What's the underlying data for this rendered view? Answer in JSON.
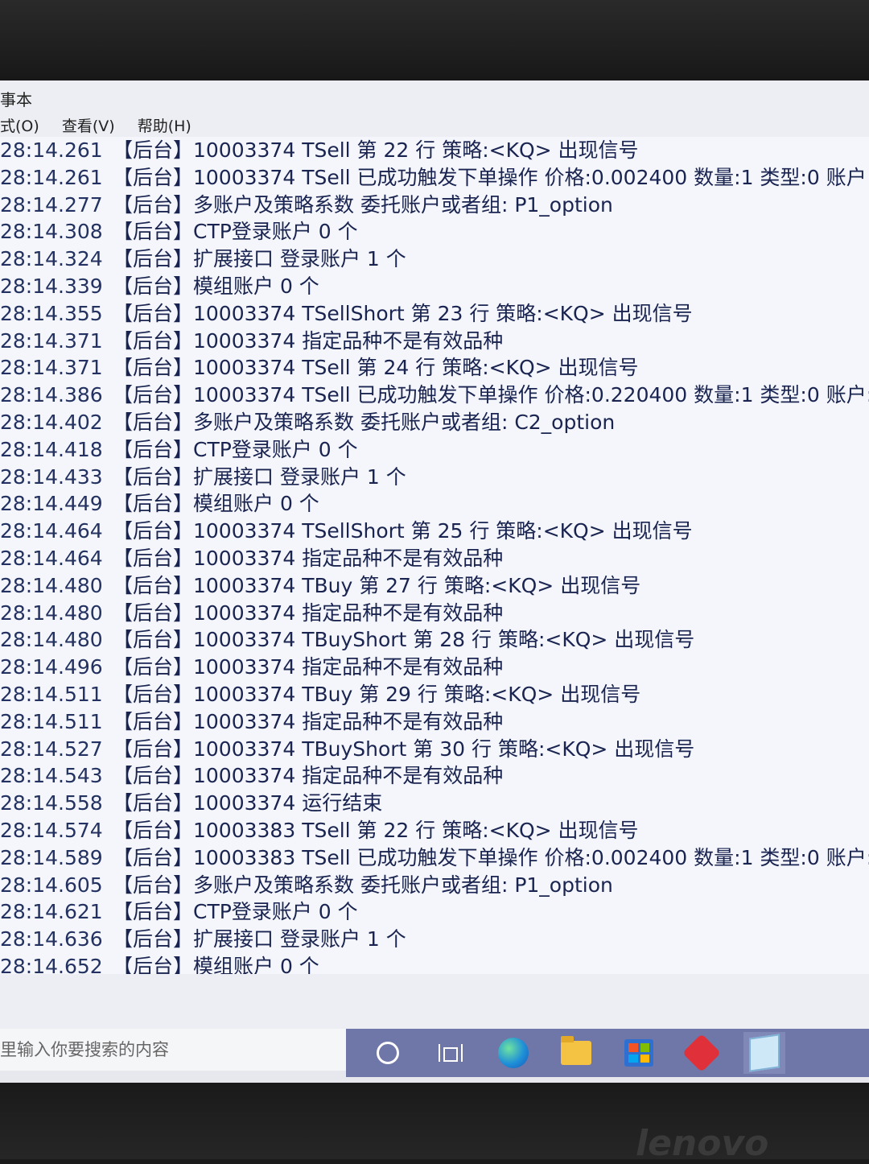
{
  "window": {
    "title": "事本",
    "menus": [
      "式(O)",
      "查看(V)",
      "帮助(H)"
    ]
  },
  "log": [
    {
      "time": "28:14.261",
      "text": "【后台】10003374 TSell 第 22 行 策略:<KQ> 出现信号"
    },
    {
      "time": "28:14.261",
      "text": "【后台】10003374 TSell 已成功触发下单操作 价格:0.002400 数量:1 类型:0 账户"
    },
    {
      "time": "28:14.277",
      "text": "【后台】多账户及策略系数 委托账户或者组:   P1_option"
    },
    {
      "time": "28:14.308",
      "text": "【后台】CTP登录账户 0 个"
    },
    {
      "time": "28:14.324",
      "text": "【后台】扩展接口 登录账户 1 个"
    },
    {
      "time": "28:14.339",
      "text": "【后台】模组账户 0 个"
    },
    {
      "time": "28:14.355",
      "text": "【后台】10003374 TSellShort 第 23 行 策略:<KQ> 出现信号"
    },
    {
      "time": "28:14.371",
      "text": "【后台】10003374 指定品种不是有效品种"
    },
    {
      "time": "28:14.371",
      "text": "【后台】10003374 TSell 第 24 行 策略:<KQ> 出现信号"
    },
    {
      "time": "28:14.386",
      "text": "【后台】10003374 TSell 已成功触发下单操作 价格:0.220400 数量:1 类型:0 账户:"
    },
    {
      "time": "28:14.402",
      "text": "【后台】多账户及策略系数 委托账户或者组:   C2_option"
    },
    {
      "time": "28:14.418",
      "text": "【后台】CTP登录账户 0 个"
    },
    {
      "time": "28:14.433",
      "text": "【后台】扩展接口 登录账户 1 个"
    },
    {
      "time": "28:14.449",
      "text": "【后台】模组账户 0 个"
    },
    {
      "time": "28:14.464",
      "text": "【后台】10003374 TSellShort 第 25 行 策略:<KQ> 出现信号"
    },
    {
      "time": "28:14.464",
      "text": "【后台】10003374 指定品种不是有效品种"
    },
    {
      "time": "28:14.480",
      "text": "【后台】10003374 TBuy 第 27 行 策略:<KQ> 出现信号"
    },
    {
      "time": "28:14.480",
      "text": "【后台】10003374 指定品种不是有效品种"
    },
    {
      "time": "28:14.480",
      "text": "【后台】10003374 TBuyShort 第 28 行 策略:<KQ> 出现信号"
    },
    {
      "time": "28:14.496",
      "text": "【后台】10003374 指定品种不是有效品种"
    },
    {
      "time": "28:14.511",
      "text": "【后台】10003374 TBuy 第 29 行 策略:<KQ> 出现信号"
    },
    {
      "time": "28:14.511",
      "text": "【后台】10003374 指定品种不是有效品种"
    },
    {
      "time": "28:14.527",
      "text": "【后台】10003374 TBuyShort 第 30 行 策略:<KQ> 出现信号"
    },
    {
      "time": "28:14.543",
      "text": "【后台】10003374 指定品种不是有效品种"
    },
    {
      "time": "28:14.558",
      "text": "【后台】10003374 运行结束"
    },
    {
      "time": "28:14.574",
      "text": "【后台】10003383 TSell 第 22 行 策略:<KQ> 出现信号"
    },
    {
      "time": "28:14.589",
      "text": "【后台】10003383 TSell 已成功触发下单操作 价格:0.002400 数量:1 类型:0 账户:"
    },
    {
      "time": "28:14.605",
      "text": "【后台】多账户及策略系数 委托账户或者组:   P1_option"
    },
    {
      "time": "28:14.621",
      "text": "【后台】CTP登录账户 0 个"
    },
    {
      "time": "28:14.636",
      "text": "【后台】扩展接口 登录账户 1 个"
    },
    {
      "time": "28:14.652",
      "text": "【后台】模组账户 0 个"
    }
  ],
  "taskbar": {
    "search_placeholder": "里输入你要搜索的内容",
    "icons": [
      "cortana-icon",
      "task-view-icon",
      "edge-icon",
      "file-explorer-icon",
      "store-icon",
      "app-icon",
      "notepad-icon"
    ]
  },
  "brand": "lenovo"
}
